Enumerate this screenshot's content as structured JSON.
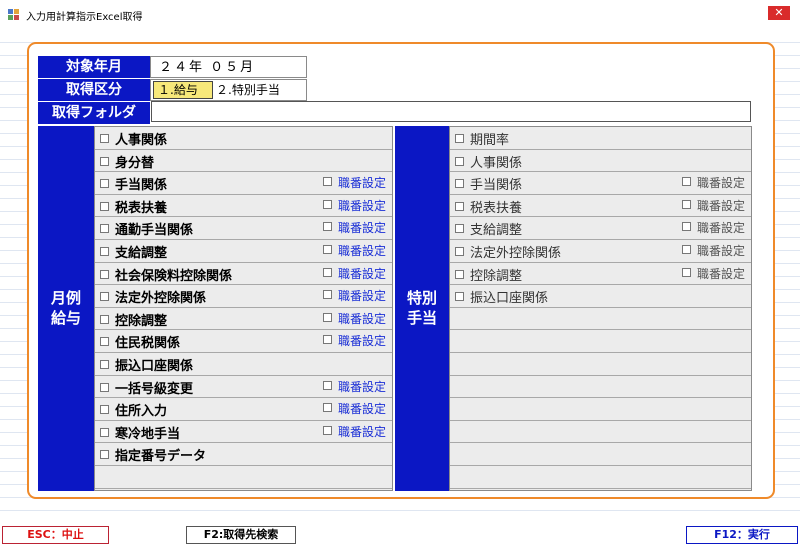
{
  "window": {
    "title": "入力用計算指示Excel取得",
    "close_glyph": "✕"
  },
  "header": {
    "target_label": "対象年月",
    "target_value": "２４年 ０５月",
    "type_label": "取得区分",
    "type_option1": "１.給与",
    "type_option2": "２.特別手当",
    "folder_label": "取得フォルダ",
    "folder_value": ""
  },
  "monthly": {
    "label_line1": "月例",
    "label_line2": "給与",
    "sub_label": "職番設定",
    "items": [
      {
        "label": "人事関係",
        "sub": false
      },
      {
        "label": "身分替",
        "sub": false
      },
      {
        "label": "手当関係",
        "sub": true
      },
      {
        "label": "税表扶養",
        "sub": true
      },
      {
        "label": "通勤手当関係",
        "sub": true
      },
      {
        "label": "支給調整",
        "sub": true
      },
      {
        "label": "社会保険料控除関係",
        "sub": true
      },
      {
        "label": "法定外控除関係",
        "sub": true
      },
      {
        "label": "控除調整",
        "sub": true
      },
      {
        "label": "住民税関係",
        "sub": true
      },
      {
        "label": "振込口座関係",
        "sub": false
      },
      {
        "label": "一括号級変更",
        "sub": true
      },
      {
        "label": "住所入力",
        "sub": true
      },
      {
        "label": "寒冷地手当",
        "sub": true
      },
      {
        "label": "指定番号データ",
        "sub": false
      }
    ]
  },
  "special": {
    "label_line1": "特別",
    "label_line2": "手当",
    "sub_label": "職番設定",
    "items": [
      {
        "label": "期間率",
        "sub": false
      },
      {
        "label": "人事関係",
        "sub": false
      },
      {
        "label": "手当関係",
        "sub": true
      },
      {
        "label": "税表扶養",
        "sub": true
      },
      {
        "label": "支給調整",
        "sub": true
      },
      {
        "label": "法定外控除関係",
        "sub": true
      },
      {
        "label": "控除調整",
        "sub": true
      },
      {
        "label": "振込口座関係",
        "sub": false
      }
    ]
  },
  "fkeys": {
    "esc": "ESC：中止",
    "f2": "F2:取得先検索",
    "f12": "F12：実行"
  },
  "colors": {
    "header_blue": "#0b17c4",
    "frame_orange": "#ef8a2a",
    "selected_yellow": "#f7e87a"
  }
}
